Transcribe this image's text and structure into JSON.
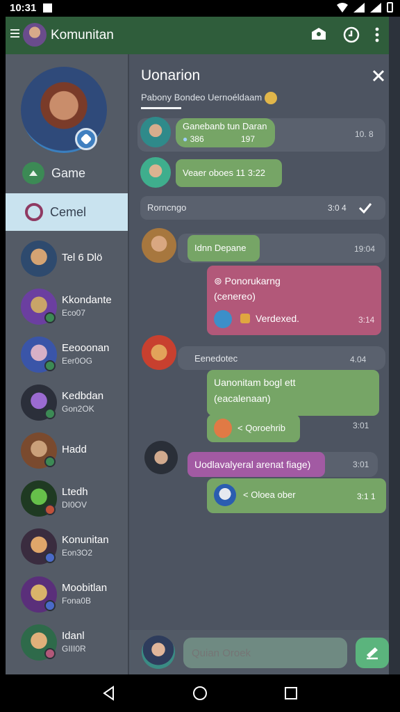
{
  "status_bar": {
    "time": "10:31"
  },
  "app_bar": {
    "title": "Komunitan"
  },
  "sidebar": {
    "nav": [
      {
        "label": "Game"
      },
      {
        "label": "Cemel"
      }
    ],
    "contacts": [
      {
        "name": "Tel 6 Dlö",
        "sub": "",
        "colors": [
          "#2e4a6e",
          "#d4a373"
        ],
        "badge": ""
      },
      {
        "name": "Kkondante",
        "sub": "Eco07",
        "colors": [
          "#6b3fa0",
          "#c9a468"
        ],
        "badge": "#3c8a55"
      },
      {
        "name": "Eeooonan",
        "sub": "Eer0OG",
        "colors": [
          "#3a55a8",
          "#d7b0c6"
        ],
        "badge": "#3c8a55"
      },
      {
        "name": "Kedbdan",
        "sub": "Gon2OK",
        "colors": [
          "#2b2f3a",
          "#9b6bd1"
        ],
        "badge": "#3c8a55"
      },
      {
        "name": "Hadd",
        "sub": "",
        "colors": [
          "#7a4a2e",
          "#caa07a"
        ],
        "badge": "#3c8a55"
      },
      {
        "name": "Ltedh",
        "sub": "DI0OV",
        "colors": [
          "#1f3a22",
          "#66c04a"
        ],
        "badge": "#c0513a"
      },
      {
        "name": "Konunitan",
        "sub": "Eon3O2",
        "colors": [
          "#3a2c3f",
          "#e0a66a"
        ],
        "badge": "#4a6ac8"
      },
      {
        "name": "Moobitlan",
        "sub": "Fona0B",
        "colors": [
          "#5a2f7a",
          "#d9b46a"
        ],
        "badge": "#4a6ac8"
      },
      {
        "name": "Idanl",
        "sub": "GIII0R",
        "colors": [
          "#2e6a4a",
          "#e0b07a"
        ],
        "badge": "#b25879"
      }
    ]
  },
  "chat": {
    "title": "Uonarion",
    "subtitle": "Pabony Bondeo Uernoéldaam",
    "composer": {
      "placeholder": "Quian Oroek"
    },
    "messages": [
      {
        "text": "Ganebanb tun Daran",
        "sub": "386",
        "sub2": "197",
        "time": "10. 8"
      },
      {
        "text": "Veaer oboes 11 3:22"
      },
      {
        "text": "Rorncngo",
        "time": "3:0 4"
      },
      {
        "text": "Idnn Depane",
        "time": "19:04"
      },
      {
        "text": "Ponorukarng",
        "text2": "(cenereo)",
        "caption": "Verdexed.",
        "time": "3:14"
      },
      {
        "text": "Eenedotec",
        "time": "4.04"
      },
      {
        "text": "Uanonitam bogl ett",
        "text2": "(eacalenaan)",
        "caption": "< Qoroehrib",
        "time": "3:01"
      },
      {
        "text": "Uodlavalyeral arenat fiage)",
        "time": "3:01"
      },
      {
        "caption": "< Oloea ober",
        "time": "3:1 1"
      }
    ]
  }
}
